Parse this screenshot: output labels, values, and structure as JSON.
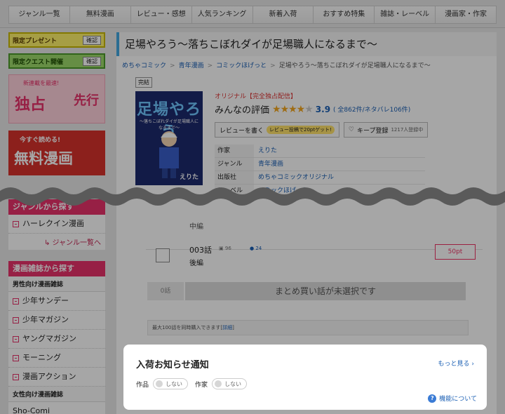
{
  "nav": {
    "tabs": [
      "ジャンル一覧",
      "無料漫画",
      "レビュー・感想",
      "人気ランキング",
      "新着入荷",
      "おすすめ特集",
      "雑誌・レーベル",
      "漫画家・作家"
    ]
  },
  "sidebar": {
    "promo_present": "限定プレゼント",
    "promo_quest": "限定クエスト開催",
    "confirm": "確認",
    "exclusive_banner": {
      "brand": "めちゃコミック",
      "small": "新連載を最速!",
      "a": "独占",
      "b": "先行"
    },
    "free_banner": {
      "a": "今すぐ読める!",
      "b": "無料漫画"
    },
    "genre_head": "ジャンルから探す",
    "genre_items": [
      "ハーレクイン漫画"
    ],
    "genre_more": "ジャンル一覧へ",
    "magazine_head": "漫画雑誌から探す",
    "male_subhead": "男性向け漫画雑誌",
    "male_items": [
      "少年サンデー",
      "少年マガジン",
      "ヤングマガジン",
      "モーニング",
      "漫画アクション"
    ],
    "female_subhead": "女性向け漫画雑誌",
    "female_items": [
      "Sho-Comi"
    ]
  },
  "title": {
    "page_title": "足場やろう〜落ちこぼれダイが足場職人になるまで〜",
    "breadcrumb": [
      "めちゃコミック",
      "青年漫画",
      "コミックほげっと",
      "足場やろう〜落ちこぼれダイが足場職人になるまで〜"
    ],
    "complete": "完結"
  },
  "cover": {
    "title": "足場やろう",
    "sub": "〜落ちこぼれダイが足場職人になるまで〜",
    "author": "えりた"
  },
  "detail": {
    "kind": "オリジナル【完全独占配信】",
    "rating_label": "みんなの評価",
    "stars": "★★★★",
    "star_off": "★",
    "rating": "3.9",
    "rating_counts": "( 全862件/ネタバレ106件)",
    "review_btn": "レビューを書く",
    "review_pill": "レビュー投稿で20ptゲット!",
    "keep_btn": "キープ登録",
    "keep_count": "1217人登録中",
    "info": [
      {
        "k": "作家",
        "v": "えりた"
      },
      {
        "k": "ジャンル",
        "v": "青年漫画"
      },
      {
        "k": "出版社",
        "v": "めちゃコミックオリジナル"
      },
      {
        "k": "レーベル",
        "v": "コミックほげっと"
      }
    ]
  },
  "chapters": {
    "prev_sub": "中編",
    "ep": "003話",
    "ep_sub": "後編",
    "likes": "96",
    "comments": "24",
    "price": "50pt"
  },
  "bulk": {
    "count": "0話",
    "message": "まとめ買い話が未選択です"
  },
  "note": {
    "text": "最大100話を同時購入できます",
    "link": "詳細"
  },
  "modal": {
    "title": "入荷お知らせ通知",
    "more": "もっと見る",
    "work_label": "作品",
    "author_label": "作家",
    "toggle_off": "しない",
    "about": "機能について"
  }
}
